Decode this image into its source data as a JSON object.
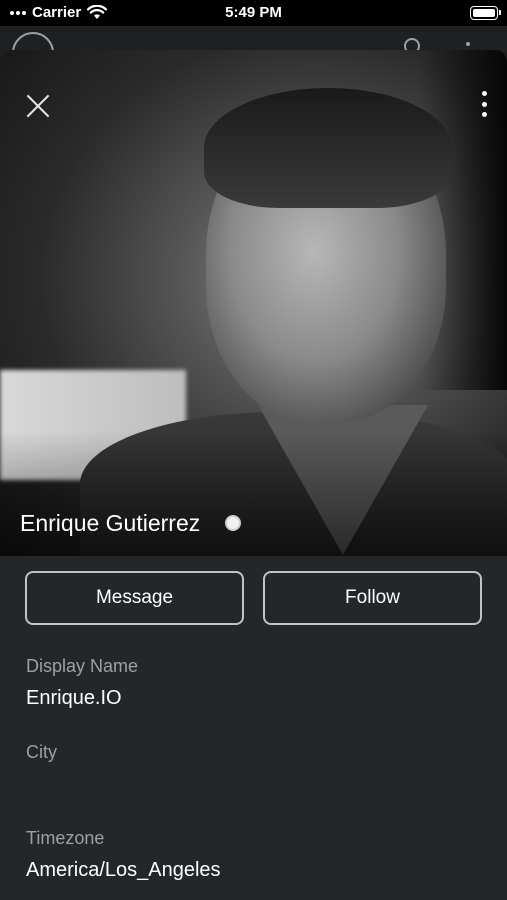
{
  "status_bar": {
    "carrier": "Carrier",
    "time": "5:49 PM",
    "icons": [
      "signal-dots-icon",
      "wifi-icon",
      "battery-icon"
    ]
  },
  "profile": {
    "name": "Enrique Gutierrez",
    "presence": "online",
    "photo": "profile-photo"
  },
  "actions": {
    "message_label": "Message",
    "follow_label": "Follow"
  },
  "fields": {
    "display_name_label": "Display Name",
    "display_name_value": "Enrique.IO",
    "city_label": "City",
    "city_value": "",
    "timezone_label": "Timezone",
    "timezone_value": "America/Los_Angeles"
  },
  "colors": {
    "background": "#24272a",
    "label": "#9ba0a5",
    "button_border": "#bfc3c7",
    "text": "#ffffff"
  }
}
